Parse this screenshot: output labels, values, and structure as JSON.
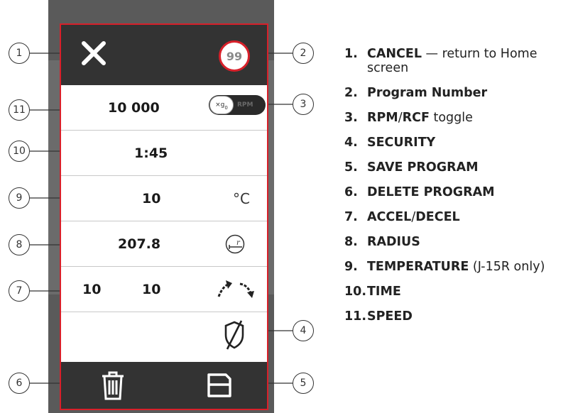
{
  "screen": {
    "program_number": "99",
    "speed": "10 000",
    "speed_toggle": {
      "left_label": "×g",
      "left_subscript": "0",
      "right_label": "RPM"
    },
    "time": "1:45",
    "temperature": "10",
    "temperature_unit": "°C",
    "radius": "207.8",
    "accel": "10",
    "decel": "10"
  },
  "callouts": [
    "1",
    "2",
    "3",
    "4",
    "5",
    "6",
    "7",
    "8",
    "9",
    "10",
    "11"
  ],
  "legend": [
    {
      "num": "1.",
      "parts": [
        {
          "text": "CANCEL",
          "bold": true
        },
        {
          "text": " — return to Home screen",
          "bold": false
        }
      ]
    },
    {
      "num": "2.",
      "parts": [
        {
          "text": "Program Number",
          "bold": true
        }
      ]
    },
    {
      "num": "3.",
      "parts": [
        {
          "text": "RPM",
          "bold": true
        },
        {
          "text": "/",
          "bold": false
        },
        {
          "text": "RCF",
          "bold": true
        },
        {
          "text": " toggle",
          "bold": false
        }
      ]
    },
    {
      "num": "4.",
      "parts": [
        {
          "text": "SECURITY",
          "bold": true
        }
      ]
    },
    {
      "num": "5.",
      "parts": [
        {
          "text": "SAVE PROGRAM",
          "bold": true
        }
      ]
    },
    {
      "num": "6.",
      "parts": [
        {
          "text": "DELETE PROGRAM",
          "bold": true
        }
      ]
    },
    {
      "num": "7.",
      "parts": [
        {
          "text": "ACCEL",
          "bold": true
        },
        {
          "text": "/",
          "bold": false
        },
        {
          "text": "DECEL",
          "bold": true
        }
      ]
    },
    {
      "num": "8.",
      "parts": [
        {
          "text": "RADIUS",
          "bold": true
        }
      ]
    },
    {
      "num": "9.",
      "parts": [
        {
          "text": "TEMPERATURE",
          "bold": true
        },
        {
          "text": " (J-15R only)",
          "bold": false
        }
      ]
    },
    {
      "num": "10.",
      "parts": [
        {
          "text": "TIME",
          "bold": true
        }
      ]
    },
    {
      "num": "11.",
      "parts": [
        {
          "text": "SPEED",
          "bold": true
        }
      ]
    }
  ],
  "colors": {
    "accent_red": "#d8202a",
    "bar_dark": "#333333",
    "device_gray": "#5a5a5a"
  }
}
